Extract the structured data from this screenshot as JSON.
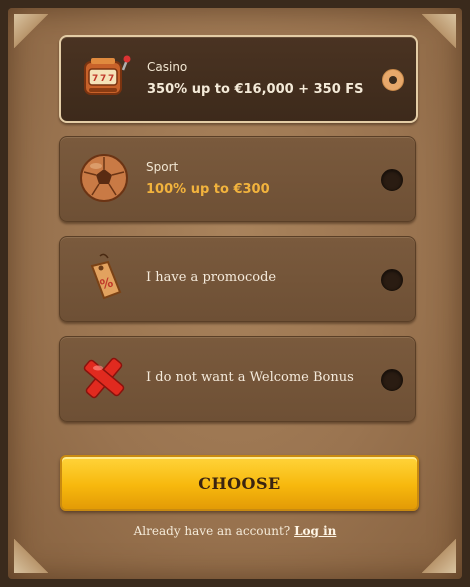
{
  "options": [
    {
      "title": "Casino",
      "subtitle": "350% up to €16,000 + 350 FS",
      "subtitle_color": "#f4ead8",
      "icon": "slot-machine-icon",
      "selected": true
    },
    {
      "title": "Sport",
      "subtitle": "100% up to €300",
      "subtitle_color": "#f2b33d",
      "icon": "soccer-ball-icon",
      "selected": false
    },
    {
      "label": "I have a promocode",
      "icon": "promo-tag-icon",
      "selected": false
    },
    {
      "label": "I do not want a Welcome Bonus",
      "icon": "red-cross-icon",
      "selected": false
    }
  ],
  "choose_button": {
    "label": "CHOOSE"
  },
  "footer": {
    "prompt": "Already have an account?",
    "link": "Log in"
  },
  "colors": {
    "accent": "#f7b80d",
    "selected_radio": "#e7a86b",
    "sport_bonus": "#f2b33d"
  }
}
